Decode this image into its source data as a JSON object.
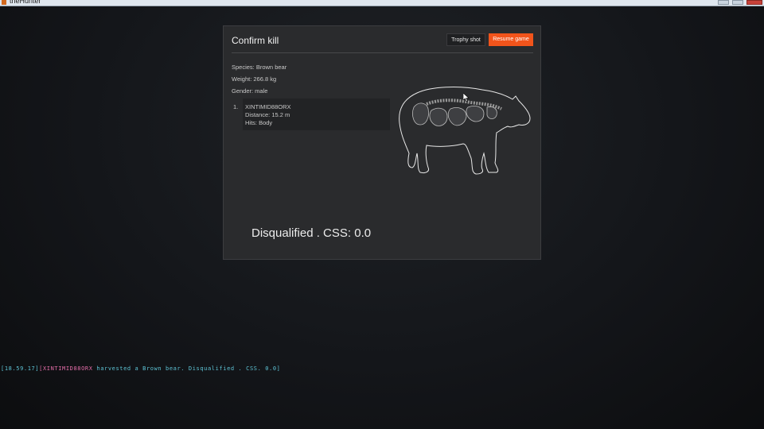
{
  "window": {
    "title": "theHunter"
  },
  "dialog": {
    "title": "Confirm kill",
    "trophy_shot_label": "Trophy shot",
    "resume_game_label": "Resume game",
    "species": "Species: Brown bear",
    "weight": "Weight: 266.8 kg",
    "gender": "Gender: male",
    "hunters": [
      {
        "index": "1.",
        "name": "XINTIMID88ORX",
        "distance": "Distance: 15.2 m",
        "hits": "Hits: Body"
      }
    ],
    "result": "Disqualified . CSS: 0.0"
  },
  "chat": {
    "timestamp": "[18.59.17]",
    "player": "[XINTIMID88ORX",
    "message": " harvested a Brown bear. Disqualified . CSS. 0.0]"
  },
  "colors": {
    "accent": "#f2541b",
    "chat_cyan": "#5ec4d6",
    "chat_pink": "#e36da8"
  }
}
